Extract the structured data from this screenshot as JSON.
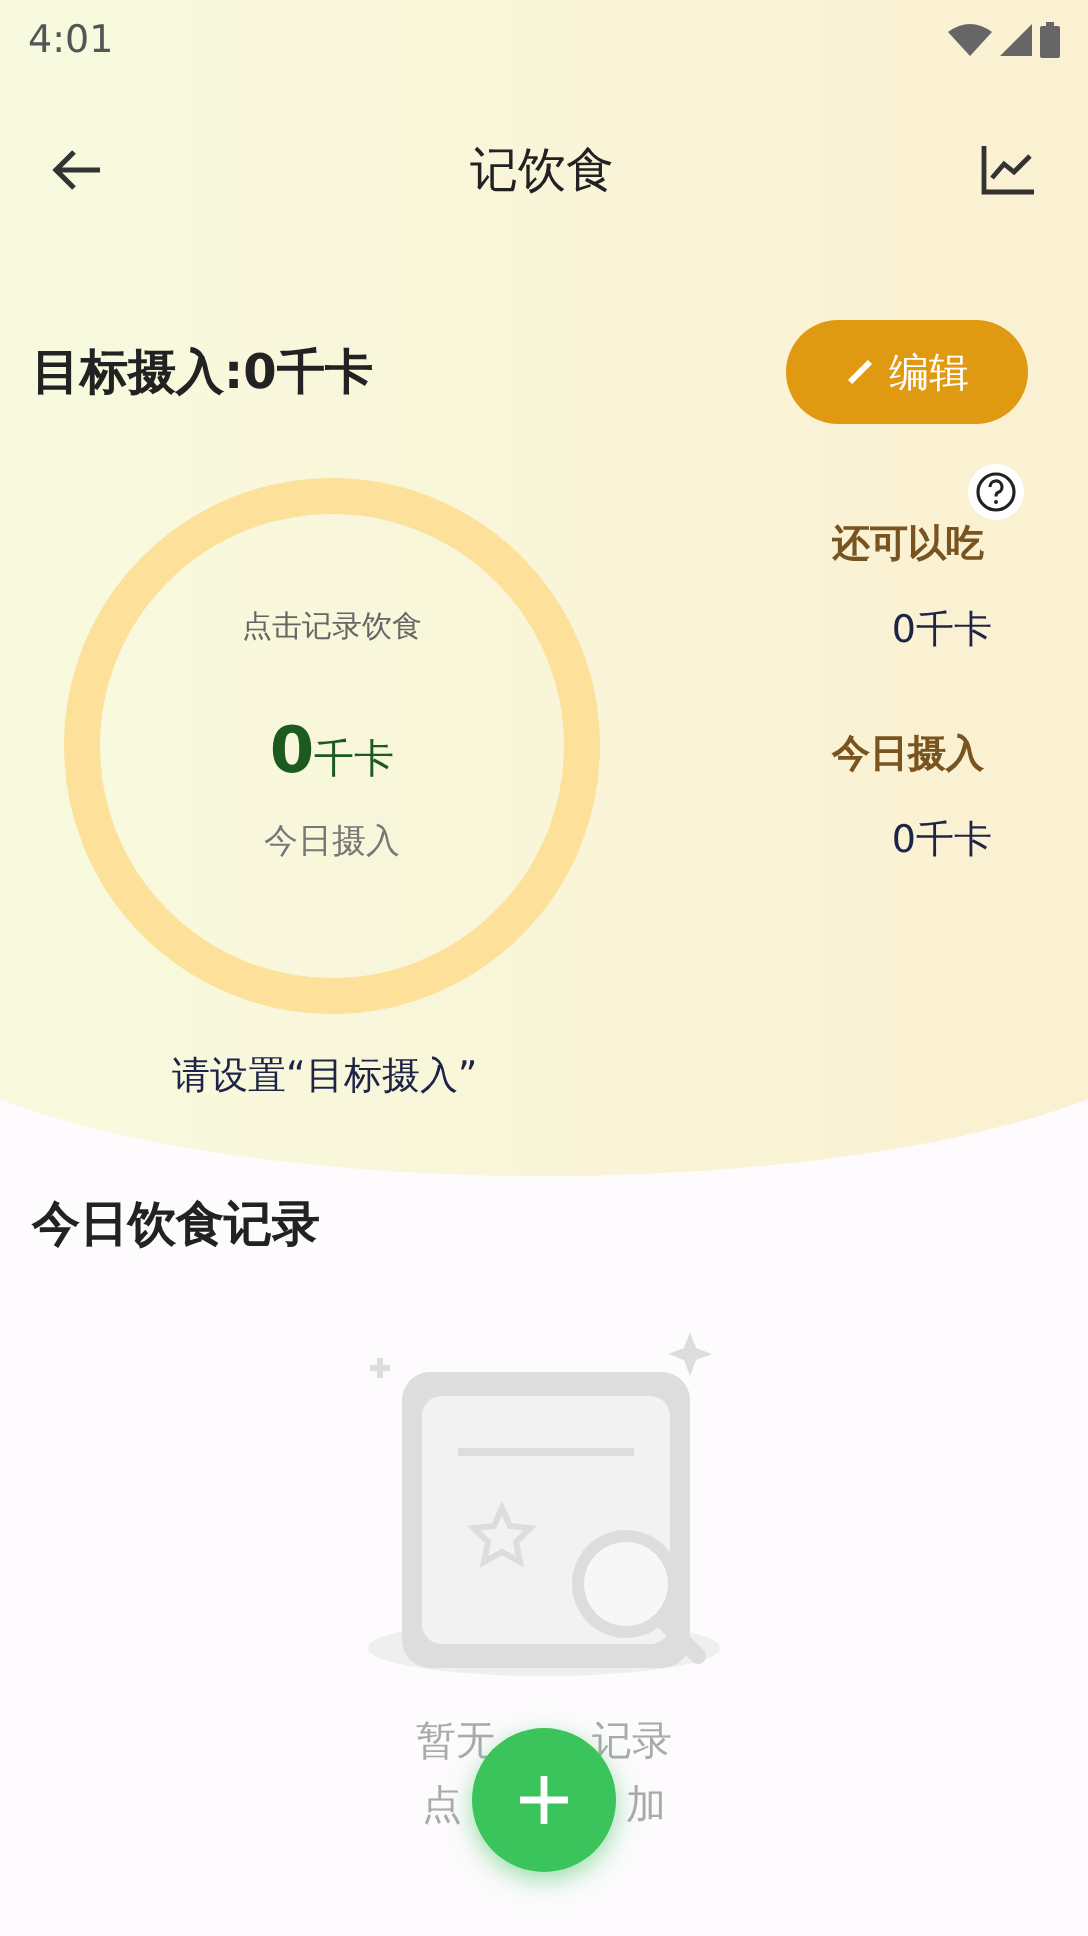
{
  "status_bar": {
    "time": "4:01"
  },
  "header": {
    "title": "记饮食"
  },
  "goal": {
    "label": "目标摄入:0千卡",
    "edit_button": "编辑"
  },
  "ring": {
    "level": 0,
    "hint": "点击记录饮食",
    "value": "0",
    "unit": "千卡",
    "caption": "今日摄入"
  },
  "stats": [
    {
      "label": "还可以吃",
      "value": "0千卡"
    },
    {
      "label": "今日摄入",
      "value": "0千卡"
    }
  ],
  "goal_notice": "请设置“目标摄入”",
  "records": {
    "title": "今日饮食记录",
    "empty_text_parts": [
      [
        "暂无",
        "记录"
      ],
      [
        "点",
        "加"
      ]
    ]
  }
}
